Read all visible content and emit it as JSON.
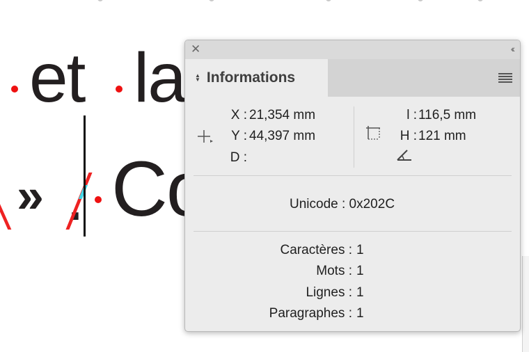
{
  "canvas": {
    "line1": ".et.la",
    "line2": "«».,/Co"
  },
  "panel": {
    "tab_label": "Informations",
    "position": {
      "x_label": "X :",
      "x_value": "21,354 mm",
      "y_label": "Y :",
      "y_value": "44,397 mm",
      "d_label": "D :"
    },
    "size": {
      "w_label": "l :",
      "w_value": "116,5 mm",
      "h_label": "H :",
      "h_value": "121 mm"
    },
    "unicode": "Unicode : 0x202C",
    "counts": [
      {
        "label": "Caractères :",
        "value": "1"
      },
      {
        "label": "Mots :",
        "value": "1"
      },
      {
        "label": "Lignes :",
        "value": "1"
      },
      {
        "label": "Paragraphes :",
        "value": "1"
      }
    ]
  },
  "icons": {
    "close": "close-icon",
    "collapse": "collapse-icon",
    "tab_arrows": "sort-arrows-icon",
    "menu": "hamburger-menu-icon",
    "crosshair": "crosshair-icon",
    "bounds": "bounding-box-icon",
    "angle": "angle-icon"
  },
  "colors": {
    "accent_red": "#ee1111",
    "cursor_cyan": "#44d6e6",
    "panel_bg": "#ececec"
  }
}
